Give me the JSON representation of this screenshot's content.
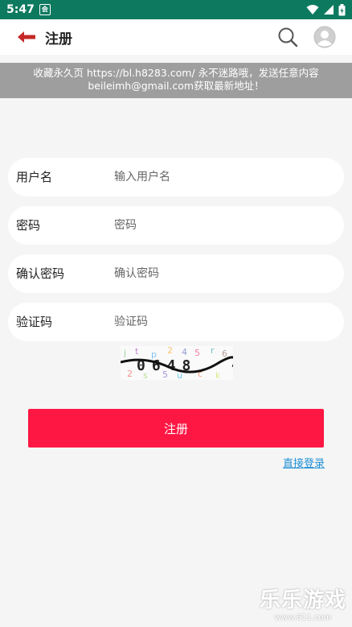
{
  "status_bar": {
    "time": "5:47",
    "notification_icon": "app-notification-icon",
    "wifi_icon": "wifi-icon",
    "signal_icon": "signal-icon",
    "battery_icon": "battery-icon"
  },
  "header": {
    "back_icon": "back-arrow-icon",
    "title": "注册",
    "search_icon": "search-icon",
    "avatar_icon": "user-avatar-icon"
  },
  "notice": {
    "line1": "收藏永久页 https://bl.h8283.com/ 永不迷路哦，发送任意内容",
    "line2": "beileimh@gmail.com获取最新地址！"
  },
  "form": {
    "username": {
      "label": "用户名",
      "placeholder": "输入用户名",
      "value": ""
    },
    "password": {
      "label": "密码",
      "placeholder": "密码",
      "value": ""
    },
    "confirm_password": {
      "label": "确认密码",
      "placeholder": "确认密码",
      "value": ""
    },
    "captcha": {
      "label": "验证码",
      "placeholder": "验证码",
      "value": ""
    },
    "captcha_image_text": "0648"
  },
  "submit_label": "注册",
  "login_link": "直接登录",
  "watermark": {
    "text": "乐乐游戏",
    "url": "www.611.com"
  },
  "colors": {
    "status_bar": "#0d7a5f",
    "accent": "#ff1744",
    "back_arrow": "#c62828",
    "link": "#1e90d6",
    "notice_bg": "#9e9e9e"
  }
}
